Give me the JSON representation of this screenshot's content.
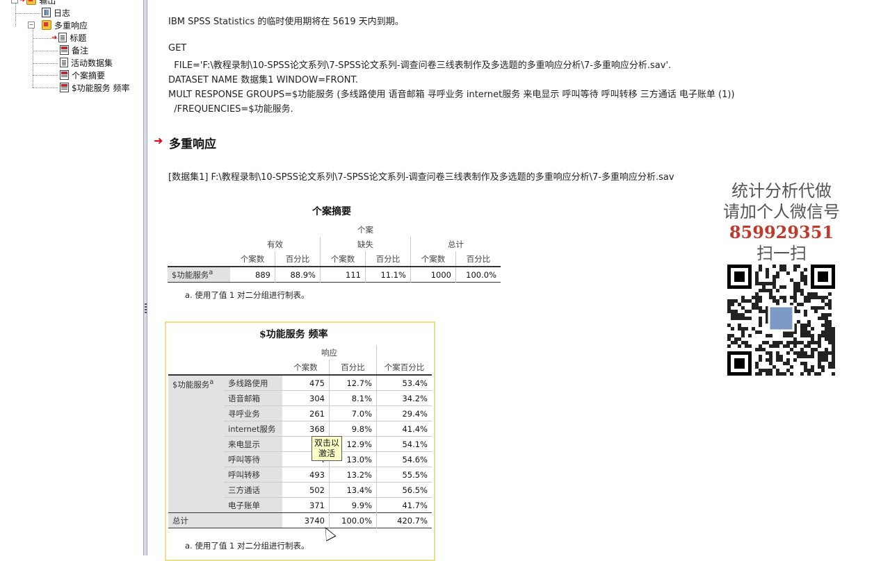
{
  "outline": {
    "root": "输出",
    "log": "日志",
    "group": "多重响应",
    "items": [
      "标题",
      "备注",
      "活动数据集",
      "个案摘要",
      "$功能服务 频率"
    ]
  },
  "log_text": {
    "license": "IBM SPSS Statistics 的临时使用期将在 5619 天内到期。",
    "get": "GET",
    "file": "  FILE='F:\\教程录制\\10-SPSS论文系列\\7-SPSS论文系列-调查问卷三线表制作及多选题的多重响应分析\\7-多重响应分析.sav'.",
    "dataset": "DATASET NAME 数据集1 WINDOW=FRONT.",
    "mult": "MULT RESPONSE GROUPS=$功能服务 (多线路使用 语音邮箱 寻呼业务 internet服务 来电显示 呼叫等待 呼叫转移 三方通话 电子账单 (1))",
    "freq": "  /FREQUENCIES=$功能服务."
  },
  "section_title": "多重响应",
  "dataset_line": "[数据集1] F:\\教程录制\\10-SPSS论文系列\\7-SPSS论文系列-调查问卷三线表制作及多选题的多重响应分析\\7-多重响应分析.sav",
  "case_summary": {
    "title": "个案摘要",
    "header_top": "个案",
    "groups": [
      "有效",
      "缺失",
      "总计"
    ],
    "sub": [
      "个案数",
      "百分比"
    ],
    "row_label": "$功能服务",
    "sup": "a",
    "values": [
      "889",
      "88.9%",
      "111",
      "11.1%",
      "1000",
      "100.0%"
    ],
    "footnote": "a. 使用了值 1 对二分组进行制表。"
  },
  "freq_table": {
    "title": "$功能服务 频率",
    "header_group": "响应",
    "col_headers": [
      "个案数",
      "百分比",
      "个案百分比"
    ],
    "row_group": "$功能服务",
    "sup": "a",
    "rows": [
      {
        "label": "多线路使用",
        "n": "475",
        "pct": "12.7%",
        "case_pct": "53.4%"
      },
      {
        "label": "语音邮箱",
        "n": "304",
        "pct": "8.1%",
        "case_pct": "34.2%"
      },
      {
        "label": "寻呼业务",
        "n": "261",
        "pct": "7.0%",
        "case_pct": "29.4%"
      },
      {
        "label": "internet服务",
        "n": "368",
        "pct": "9.8%",
        "case_pct": "41.4%"
      },
      {
        "label": "来电显示",
        "n": "4",
        "pct": "12.9%",
        "case_pct": "54.1%"
      },
      {
        "label": "呼叫等待",
        "n": "4",
        "pct": "13.0%",
        "case_pct": "54.6%"
      },
      {
        "label": "呼叫转移",
        "n": "493",
        "pct": "13.2%",
        "case_pct": "55.5%"
      },
      {
        "label": "三方通话",
        "n": "502",
        "pct": "13.4%",
        "case_pct": "56.5%"
      },
      {
        "label": "电子账单",
        "n": "371",
        "pct": "9.9%",
        "case_pct": "41.7%"
      }
    ],
    "total": {
      "label": "总计",
      "n": "3740",
      "pct": "100.0%",
      "case_pct": "420.7%"
    },
    "footnote": "a. 使用了值 1 对二分组进行制表。"
  },
  "tooltip": "双击以激活",
  "watermark": {
    "line1": "统计分析代做",
    "line2_prefix": "请加个人微信号",
    "line2_number": "859929351",
    "line3": "扫一扫"
  },
  "colors": {
    "accent_red": "#e01",
    "watermark_number": "#c0392b",
    "frame": "#ede08a"
  }
}
